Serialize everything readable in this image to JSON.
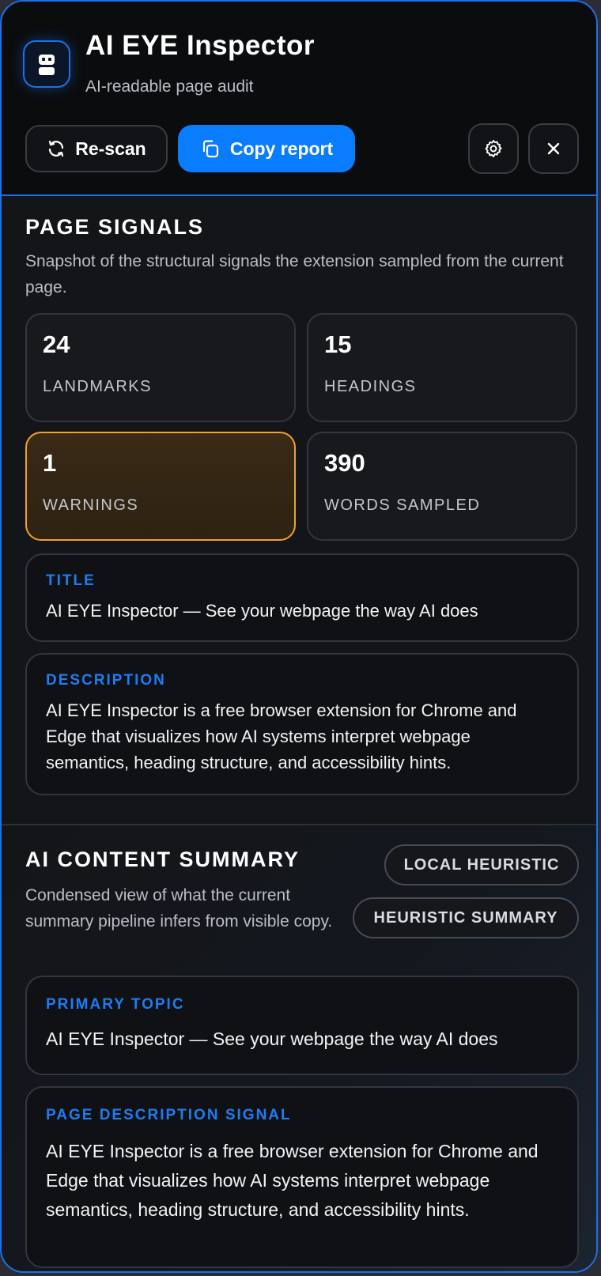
{
  "header": {
    "title": "AI EYE Inspector",
    "subtitle": "AI-readable page audit",
    "rescan_label": "Re-scan",
    "copy_label": "Copy report"
  },
  "signals": {
    "title": "PAGE SIGNALS",
    "description": "Snapshot of the structural signals the extension sampled from the current page.",
    "stats": [
      {
        "value": "24",
        "label": "LANDMARKS"
      },
      {
        "value": "15",
        "label": "HEADINGS"
      },
      {
        "value": "1",
        "label": "WARNINGS"
      },
      {
        "value": "390",
        "label": "WORDS SAMPLED"
      }
    ],
    "title_card": {
      "tag": "TITLE",
      "text": "AI EYE Inspector — See your webpage the way AI does"
    },
    "description_card": {
      "tag": "DESCRIPTION",
      "text": "AI EYE Inspector is a free browser extension for Chrome and Edge that visualizes how AI systems interpret webpage semantics, heading structure, and accessibility hints."
    }
  },
  "summary": {
    "title": "AI CONTENT SUMMARY",
    "description": "Condensed view of what the current summary pipeline infers from visible copy.",
    "badges": [
      "LOCAL HEURISTIC",
      "HEURISTIC SUMMARY"
    ],
    "topic_card": {
      "tag": "PRIMARY TOPIC",
      "text": "AI EYE Inspector — See your webpage the way AI does"
    },
    "signal_card": {
      "tag": "PAGE DESCRIPTION SIGNAL",
      "text": "AI EYE Inspector is a free browser extension for Chrome and Edge that visualizes how AI systems interpret webpage semantics, heading structure, and accessibility hints."
    }
  },
  "colors": {
    "accent": "#0a7cff",
    "warning": "#f0a325",
    "tag": "#1a7df5"
  },
  "icons": [
    "robot-logo-icon",
    "refresh-icon",
    "copy-icon",
    "gear-icon",
    "close-icon"
  ]
}
